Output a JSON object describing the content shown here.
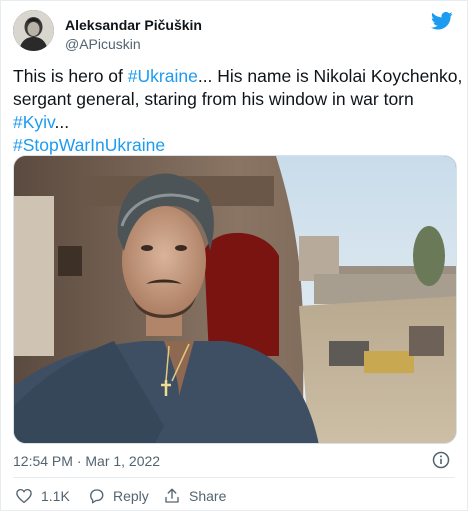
{
  "author": {
    "name": "Aleksandar Pičuškin",
    "handle": "@APicuskin"
  },
  "tweet": {
    "line1_prefix": "This is hero of ",
    "line1_tag": "#Ukraine",
    "line1_suffix": "... His name is Nikolai Koychenko,",
    "line2": "sergant general, staring from his window in war torn",
    "line3_tag": "#Kyiv",
    "line3_suffix": "...",
    "line4_tag": "#StopWarInUkraine"
  },
  "meta": {
    "timestamp": "12:54 PM · Mar 1, 2022"
  },
  "actions": {
    "like_count": "1.1K",
    "reply_label": "Reply",
    "share_label": "Share"
  },
  "colors": {
    "link": "#1d9bf0",
    "twitter_blue": "#1d9bf0",
    "muted": "#536471"
  },
  "icons": [
    "twitter-bird-icon",
    "info-icon",
    "heart-icon",
    "reply-icon",
    "share-icon"
  ]
}
